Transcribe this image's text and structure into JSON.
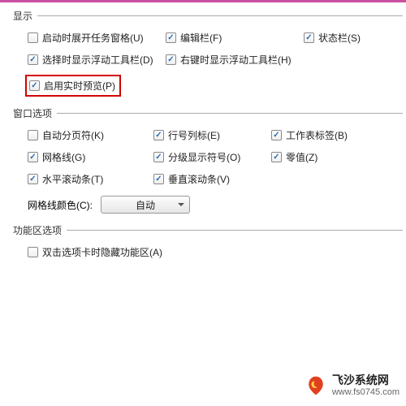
{
  "sections": {
    "display": {
      "title": "显示",
      "options": [
        {
          "label": "启动时展开任务窗格(U)",
          "checked": false
        },
        {
          "label": "编辑栏(F)",
          "checked": true
        },
        {
          "label": "状态栏(S)",
          "checked": true
        },
        {
          "label": "选择时显示浮动工具栏(D)",
          "checked": true
        },
        {
          "label": "右键时显示浮动工具栏(H)",
          "checked": true
        },
        {
          "label": "启用实时预览(P)",
          "checked": true,
          "highlight": true
        }
      ]
    },
    "window_options": {
      "title": "窗口选项",
      "options": [
        {
          "label": "自动分页符(K)",
          "checked": false
        },
        {
          "label": "行号列标(E)",
          "checked": true
        },
        {
          "label": "工作表标签(B)",
          "checked": true
        },
        {
          "label": "网格线(G)",
          "checked": true
        },
        {
          "label": "分级显示符号(O)",
          "checked": true
        },
        {
          "label": "零值(Z)",
          "checked": true
        },
        {
          "label": "水平滚动条(T)",
          "checked": true
        },
        {
          "label": "垂直滚动条(V)",
          "checked": true
        }
      ],
      "gridline_color_label": "网格线颜色(C):",
      "gridline_color_value": "自动"
    },
    "ribbon_options": {
      "title": "功能区选项",
      "option_label": "双击选项卡时隐藏功能区(A)",
      "checked": false
    }
  },
  "watermark": {
    "title": "飞沙系统网",
    "url": "www.fs0745.com"
  }
}
